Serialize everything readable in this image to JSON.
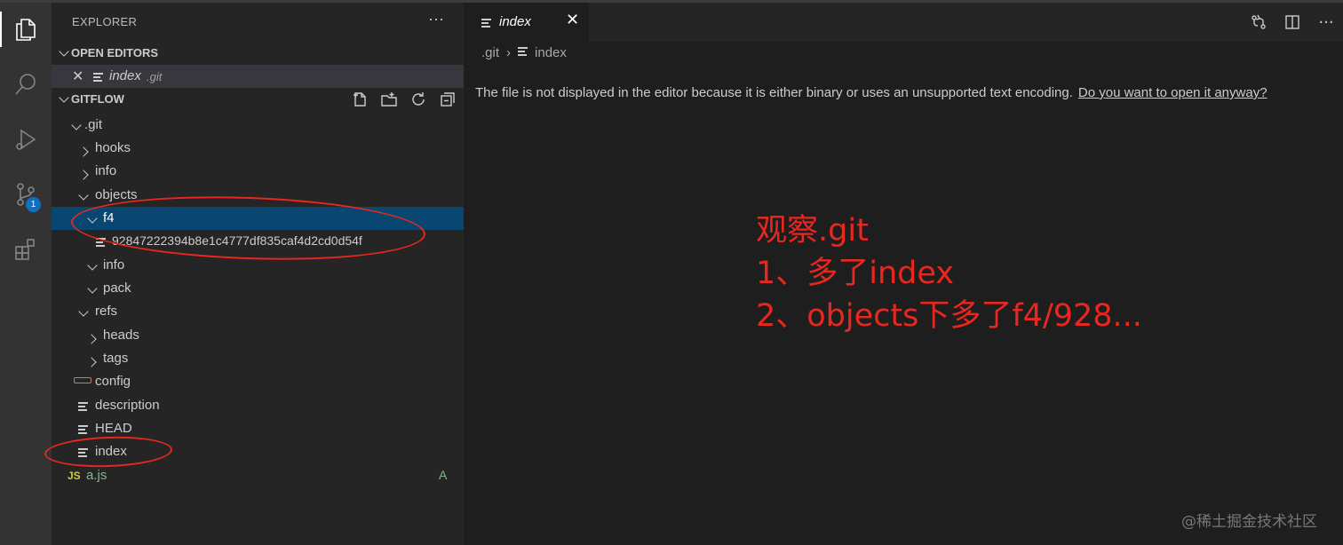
{
  "sidebar": {
    "title": "EXPLORER",
    "more": "···",
    "open_editors": {
      "label": "OPEN EDITORS",
      "item_name": "index",
      "item_path": ".git"
    },
    "workspace": {
      "label": "GITFLOW"
    },
    "tree": [
      {
        "label": ".git",
        "kind": "folder-open"
      },
      {
        "label": "hooks",
        "kind": "folder"
      },
      {
        "label": "info",
        "kind": "folder"
      },
      {
        "label": "objects",
        "kind": "folder-open"
      },
      {
        "label": "f4",
        "kind": "folder-open"
      },
      {
        "label": "92847222394b8e1c4777df835caf4d2cd0d54f",
        "kind": "file"
      },
      {
        "label": "info",
        "kind": "folder"
      },
      {
        "label": "pack",
        "kind": "folder"
      },
      {
        "label": "refs",
        "kind": "folder-open"
      },
      {
        "label": "heads",
        "kind": "folder"
      },
      {
        "label": "tags",
        "kind": "folder"
      },
      {
        "label": "config",
        "kind": "file"
      },
      {
        "label": "description",
        "kind": "file"
      },
      {
        "label": "HEAD",
        "kind": "file"
      },
      {
        "label": "index",
        "kind": "file"
      },
      {
        "label": "a.js",
        "kind": "js",
        "status": "A",
        "icon_text": "JS"
      }
    ]
  },
  "activity": {
    "scm_badge": "1"
  },
  "editor": {
    "tab_label": "index",
    "close": "✕",
    "breadcrumb": [
      ".git",
      "index"
    ],
    "message": "The file is not displayed in the editor because it is either binary or uses an unsupported text encoding.",
    "open_anyway": "Do you want to open it anyway?"
  },
  "annotation": {
    "lines": [
      "观察.git",
      "1、多了index",
      "2、objects下多了f4/928..."
    ]
  },
  "watermark": "@稀土掘金技术社区",
  "colors": {
    "selected_row": "#094771",
    "annotation": "#e8271e",
    "js_icon": "#cbcb41",
    "added_status": "#81b88b"
  }
}
